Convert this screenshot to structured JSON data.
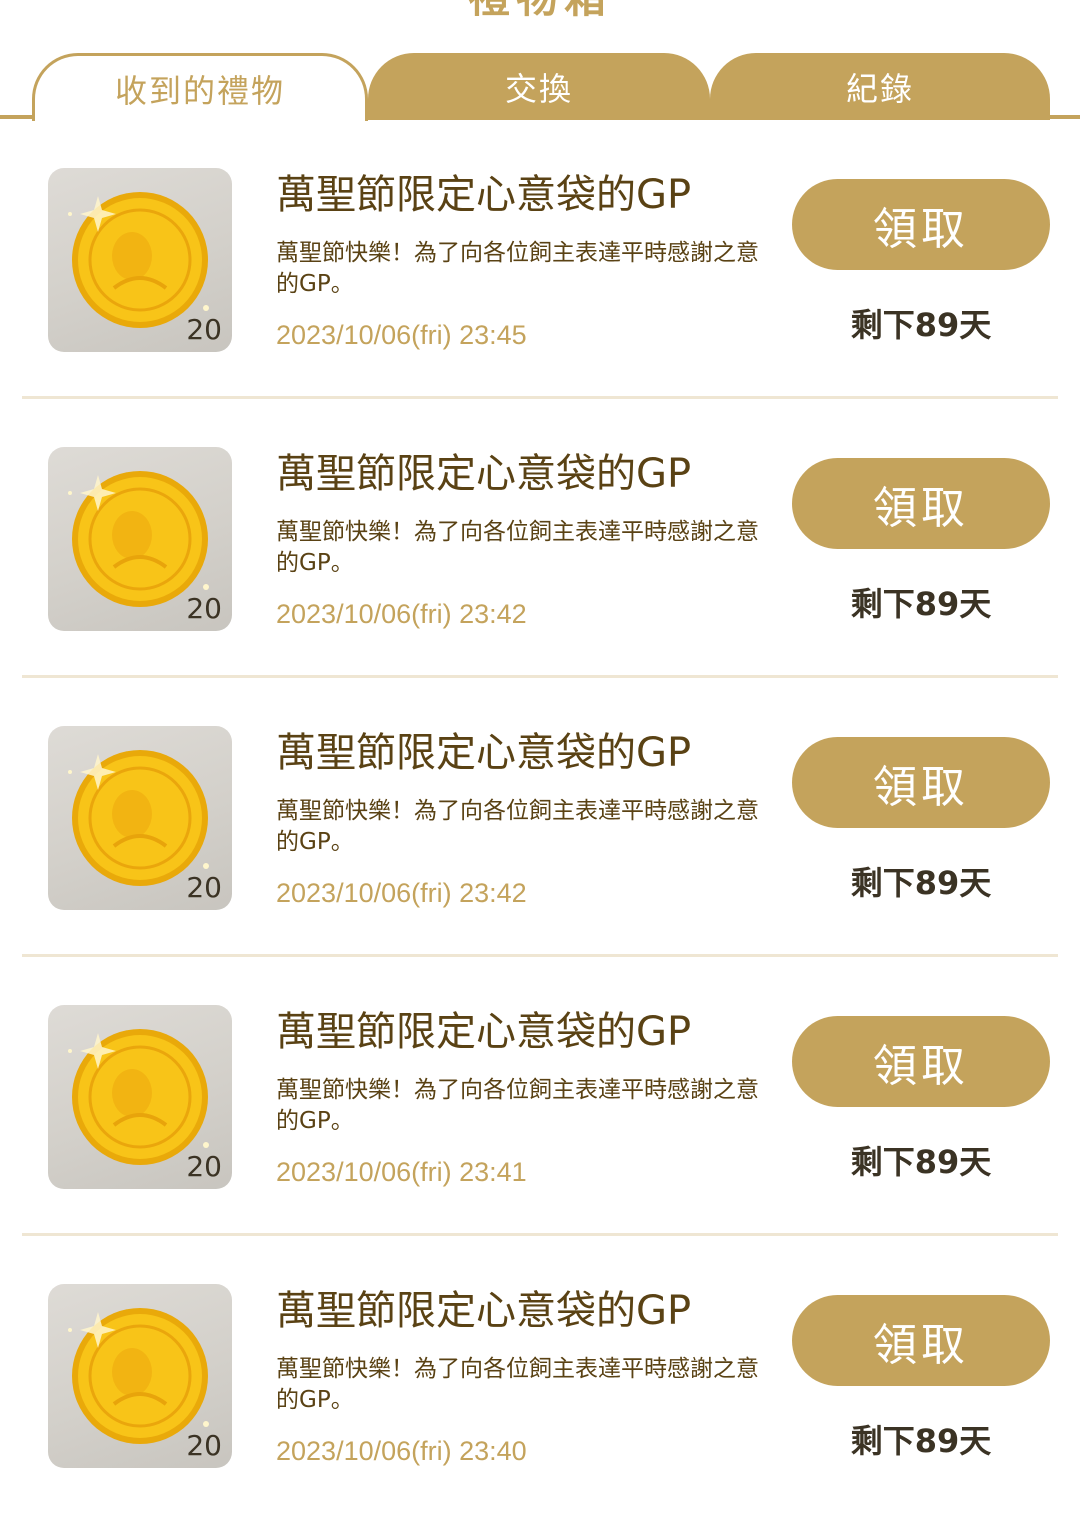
{
  "page": {
    "title": "禮物箱"
  },
  "tabs": [
    {
      "label": "收到的禮物",
      "active": true
    },
    {
      "label": "交換",
      "active": false
    },
    {
      "label": "紀錄",
      "active": false
    }
  ],
  "colors": {
    "accent": "#C4A35C",
    "title_text": "#5a4214",
    "divider": "#EFE6D3"
  },
  "gifts": [
    {
      "icon": "gold-coin-icon",
      "quantity": "20",
      "title": "萬聖節限定心意袋的GP",
      "description": "萬聖節快樂！為了向各位飼主表達平時感謝之意的GP。",
      "timestamp": "2023/10/06(fri) 23:45",
      "button_label": "領取",
      "remaining": "剩下89天"
    },
    {
      "icon": "gold-coin-icon",
      "quantity": "20",
      "title": "萬聖節限定心意袋的GP",
      "description": "萬聖節快樂！為了向各位飼主表達平時感謝之意的GP。",
      "timestamp": "2023/10/06(fri) 23:42",
      "button_label": "領取",
      "remaining": "剩下89天"
    },
    {
      "icon": "gold-coin-icon",
      "quantity": "20",
      "title": "萬聖節限定心意袋的GP",
      "description": "萬聖節快樂！為了向各位飼主表達平時感謝之意的GP。",
      "timestamp": "2023/10/06(fri) 23:42",
      "button_label": "領取",
      "remaining": "剩下89天"
    },
    {
      "icon": "gold-coin-icon",
      "quantity": "20",
      "title": "萬聖節限定心意袋的GP",
      "description": "萬聖節快樂！為了向各位飼主表達平時感謝之意的GP。",
      "timestamp": "2023/10/06(fri) 23:41",
      "button_label": "領取",
      "remaining": "剩下89天"
    },
    {
      "icon": "gold-coin-icon",
      "quantity": "20",
      "title": "萬聖節限定心意袋的GP",
      "description": "萬聖節快樂！為了向各位飼主表達平時感謝之意的GP。",
      "timestamp": "2023/10/06(fri) 23:40",
      "button_label": "領取",
      "remaining": "剩下89天"
    }
  ]
}
